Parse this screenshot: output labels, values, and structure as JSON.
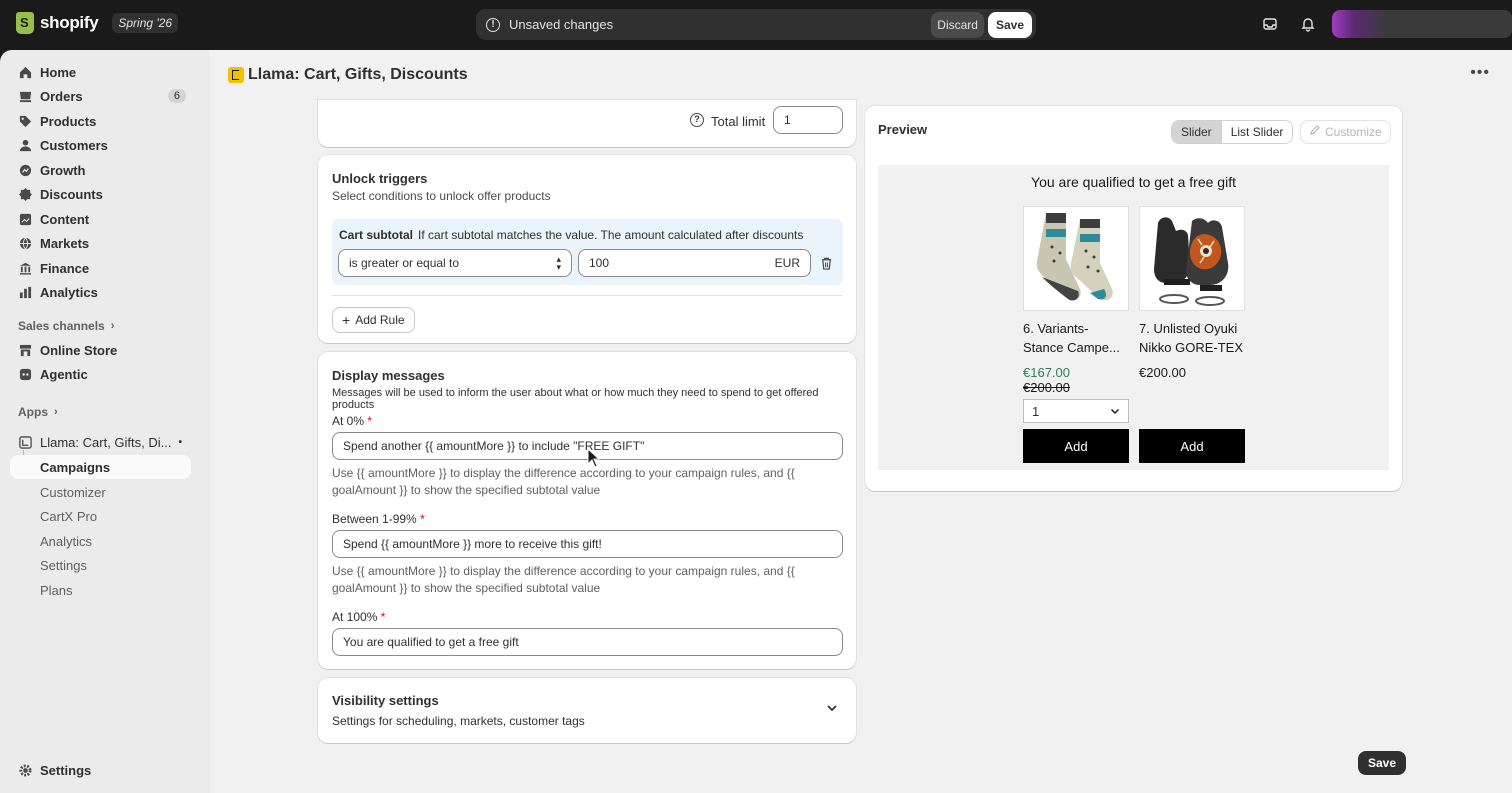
{
  "topbar": {
    "logo_text": "shopify",
    "edition": "Spring '26",
    "unsaved_text": "Unsaved changes",
    "discard_label": "Discard",
    "save_label": "Save"
  },
  "sidebar": {
    "items": [
      {
        "label": "Home",
        "icon": "home-icon"
      },
      {
        "label": "Orders",
        "icon": "orders-icon",
        "count": "6"
      },
      {
        "label": "Products",
        "icon": "tag-icon"
      },
      {
        "label": "Customers",
        "icon": "person-icon"
      },
      {
        "label": "Growth",
        "icon": "growth-icon"
      },
      {
        "label": "Discounts",
        "icon": "discount-icon"
      },
      {
        "label": "Content",
        "icon": "content-icon"
      },
      {
        "label": "Markets",
        "icon": "globe-icon"
      },
      {
        "label": "Finance",
        "icon": "bank-icon"
      },
      {
        "label": "Analytics",
        "icon": "chart-icon"
      }
    ],
    "sales_channels_label": "Sales channels",
    "channels": [
      {
        "label": "Online Store",
        "icon": "store-icon"
      },
      {
        "label": "Agentic",
        "icon": "agentic-icon"
      }
    ],
    "apps_label": "Apps",
    "app_name": "Llama: Cart, Gifts, Di...",
    "app_sub": [
      "Campaigns",
      "Customizer",
      "CartX Pro",
      "Analytics",
      "Settings",
      "Plans"
    ],
    "settings_label": "Settings"
  },
  "page": {
    "title": "Llama: Cart, Gifts, Discounts",
    "more_label": "•••"
  },
  "limit_card": {
    "label": "Total limit",
    "value": "1"
  },
  "unlock": {
    "title": "Unlock triggers",
    "subtitle": "Select conditions to unlock offer products",
    "rule_name": "Cart subtotal",
    "rule_desc": "If cart subtotal matches the value. The amount calculated after discounts",
    "operator": "is greater or equal to",
    "amount": "100",
    "currency": "EUR",
    "add_rule_label": "Add Rule"
  },
  "messages": {
    "title": "Display messages",
    "subtitle": "Messages will be used to inform the user about what or how much they need to spend to get offered products",
    "fields": [
      {
        "label": "At 0%",
        "value": "Spend another {{ amountMore }} to include \"FREE GIFT\"",
        "help1": "Use {{ amountMore }} to display the difference according to your campaign rules, and {{",
        "help2": "goalAmount }} to show the specified subtotal value"
      },
      {
        "label": "Between 1-99%",
        "value": "Spend {{ amountMore }} more to receive this gift!",
        "help1": "Use {{ amountMore }} to display the difference according to your campaign rules, and {{",
        "help2": "goalAmount }} to show the specified subtotal value"
      },
      {
        "label": "At 100%",
        "value": "You are qualified to get a free gift"
      }
    ],
    "required_mark": "*"
  },
  "visibility": {
    "title": "Visibility settings",
    "subtitle": "Settings for scheduling, markets, customer tags"
  },
  "preview": {
    "title": "Preview",
    "tabs": [
      "Slider",
      "List Slider"
    ],
    "customize_label": "Customize",
    "headline": "You are qualified to get a free gift",
    "products": [
      {
        "name1": "6. Variants-",
        "name2": "Stance Campe...",
        "sale_price": "€167.00",
        "old_price": "€200.00",
        "qty": "1",
        "add_label": "Add"
      },
      {
        "name1": "7. Unlisted Oyuki",
        "name2": "Nikko GORE-TEX",
        "price": "€200.00",
        "add_label": "Add"
      }
    ]
  },
  "footer": {
    "save_label": "Save"
  }
}
